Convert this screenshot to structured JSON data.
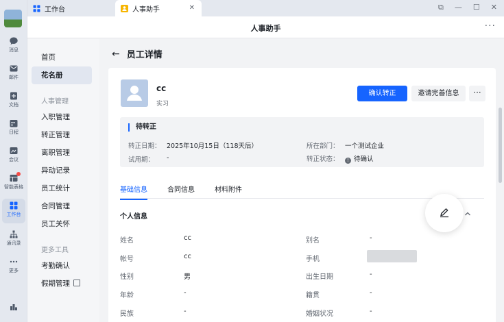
{
  "rail": {
    "items": [
      {
        "label": "消息",
        "icon": "chat-bubble-icon"
      },
      {
        "label": "邮件",
        "icon": "mail-icon"
      },
      {
        "label": "文档",
        "icon": "document-icon"
      },
      {
        "label": "日程",
        "icon": "calendar-icon"
      },
      {
        "label": "会议",
        "icon": "meeting-icon"
      },
      {
        "label": "智能表格",
        "icon": "smart-table-icon"
      },
      {
        "label": "工作台",
        "icon": "workbench-grid-icon"
      },
      {
        "label": "通讯录",
        "icon": "org-chart-icon"
      },
      {
        "label": "更多",
        "icon": "more-dots-icon"
      }
    ],
    "active_label": "工作台",
    "bottom_icon": "bar-chart-icon"
  },
  "tabs": [
    {
      "label": "工作台",
      "icon": "workbench-grid-icon"
    },
    {
      "label": "人事助手",
      "icon": "hr-assistant-icon"
    }
  ],
  "window": {
    "title": "人事助手",
    "more": "···"
  },
  "nav": {
    "items_top": [
      "首页",
      "花名册"
    ],
    "group1_label": "人事管理",
    "group1_items": [
      "入职管理",
      "转正管理",
      "离职管理",
      "异动记录",
      "员工统计",
      "合同管理",
      "员工关怀"
    ],
    "group2_label": "更多工具",
    "group2_items": [
      "考勤确认",
      "假期管理"
    ]
  },
  "page": {
    "title": "员工详情"
  },
  "employee": {
    "name": "cc",
    "type": "实习",
    "primary_button": "确认转正",
    "secondary_button": "邀请完善信息",
    "more_button": "···"
  },
  "status": {
    "title": "待转正",
    "regular_date_label": "转正日期：",
    "regular_date_value": "2025年10月15日（118天后）",
    "probation_label": "试用期：",
    "probation_value": "-",
    "dept_label": "所在部门：",
    "dept_value": "一个测试企业",
    "state_label": "转正状态：",
    "state_value": "待确认"
  },
  "detail_tabs": [
    "基础信息",
    "合同信息",
    "材料附件"
  ],
  "section": {
    "title": "个人信息"
  },
  "fields": {
    "left": [
      {
        "label": "姓名",
        "value": "cc"
      },
      {
        "label": "帐号",
        "value": "cc"
      },
      {
        "label": "性别",
        "value": "男"
      },
      {
        "label": "年龄",
        "value": "-"
      },
      {
        "label": "民族",
        "value": "-"
      }
    ],
    "right": [
      {
        "label": "别名",
        "value": "-"
      },
      {
        "label": "手机",
        "value": ""
      },
      {
        "label": "出生日期",
        "value": "-"
      },
      {
        "label": "籍贯",
        "value": "-"
      },
      {
        "label": "婚姻状况",
        "value": "-"
      }
    ]
  },
  "colors": {
    "accent": "#1664ff",
    "badge": "#f54a45",
    "photo_bg": "#b8cbe6"
  }
}
